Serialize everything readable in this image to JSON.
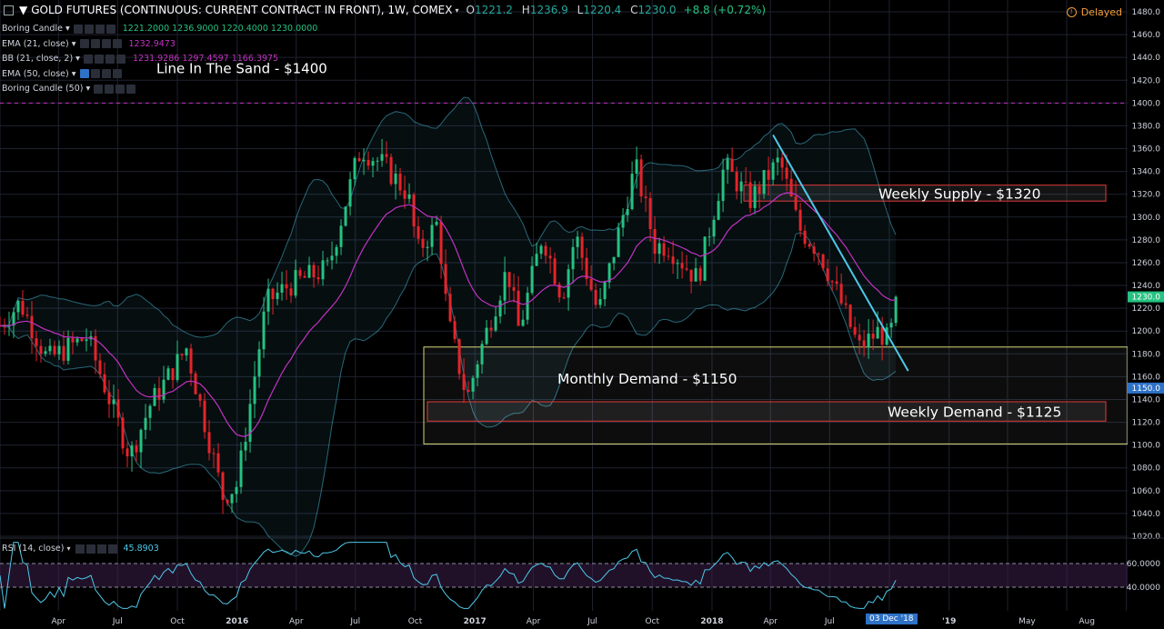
{
  "header": {
    "title": "GOLD FUTURES (CONTINUOUS: CURRENT CONTRACT IN FRONT), 1W, COMEX",
    "ohlc": {
      "o_label": "O",
      "o": "1221.2",
      "h_label": "H",
      "h": "1236.9",
      "l_label": "L",
      "l": "1220.4",
      "c_label": "C",
      "c": "1230.0"
    },
    "change": "+8.8 (+0.72%)",
    "delayed": "Delayed"
  },
  "indicators": [
    {
      "label": "Boring Candle",
      "values": [
        "1221.2000",
        "1236.9000",
        "1220.4000",
        "1230.0000"
      ],
      "color": "#26c281"
    },
    {
      "label": "EMA (21, close)",
      "values": [
        "1232.9473"
      ],
      "color": "#c232c2"
    },
    {
      "label": "BB (21, close, 2)",
      "values": [
        "1231.9286",
        "1297.4597",
        "1166.3975"
      ],
      "color": "#c232c2"
    },
    {
      "label": "EMA (50, close)",
      "values": [],
      "color": "#cfd3dc"
    },
    {
      "label": "Boring Candle (50)",
      "values": [],
      "color": "#cfd3dc"
    }
  ],
  "rsi": {
    "label": "RSI (14, close)",
    "value": "45.8903",
    "color": "#4ec8e8"
  },
  "date_tag": "03 Dec '18",
  "chart_data": {
    "type": "candlestick",
    "title": "GOLD FUTURES (CONTINUOUS: CURRENT CONTRACT IN FRONT), 1W, COMEX",
    "ylim": [
      1020,
      1480
    ],
    "y_ticks": [
      1020,
      1040,
      1060,
      1080,
      1100,
      1120,
      1140,
      1160,
      1180,
      1200,
      1220,
      1240,
      1260,
      1280,
      1300,
      1320,
      1340,
      1360,
      1380,
      1400,
      1420,
      1440,
      1460,
      1480
    ],
    "x_ticks": [
      "Apr",
      "Jul",
      "Oct",
      "2016",
      "Apr",
      "Jul",
      "Oct",
      "2017",
      "Apr",
      "Jul",
      "Oct",
      "2018",
      "Apr",
      "Jul",
      "Oct",
      "'19",
      "May",
      "Aug"
    ],
    "price_anchors": [
      [
        "2015-01-01",
        1205
      ],
      [
        "2015-02-01",
        1225
      ],
      [
        "2015-03-15",
        1175
      ],
      [
        "2015-05-15",
        1195
      ],
      [
        "2015-07-20",
        1090
      ],
      [
        "2015-08-20",
        1135
      ],
      [
        "2015-10-15",
        1185
      ],
      [
        "2015-12-10",
        1055
      ],
      [
        "2016-01-01",
        1065
      ],
      [
        "2016-02-15",
        1225
      ],
      [
        "2016-03-20",
        1240
      ],
      [
        "2016-05-20",
        1255
      ],
      [
        "2016-07-01",
        1345
      ],
      [
        "2016-07-10",
        1360
      ],
      [
        "2016-08-15",
        1345
      ],
      [
        "2016-09-20",
        1320
      ],
      [
        "2016-10-05",
        1270
      ],
      [
        "2016-11-05",
        1295
      ],
      [
        "2016-11-20",
        1210
      ],
      [
        "2016-12-20",
        1140
      ],
      [
        "2017-01-05",
        1175
      ],
      [
        "2017-02-20",
        1255
      ],
      [
        "2017-03-10",
        1200
      ],
      [
        "2017-04-15",
        1285
      ],
      [
        "2017-05-15",
        1230
      ],
      [
        "2017-06-05",
        1285
      ],
      [
        "2017-07-10",
        1215
      ],
      [
        "2017-09-05",
        1345
      ],
      [
        "2017-10-05",
        1275
      ],
      [
        "2017-10-25",
        1275
      ],
      [
        "2017-12-10",
        1245
      ],
      [
        "2018-01-20",
        1345
      ],
      [
        "2018-03-01",
        1315
      ],
      [
        "2018-04-15",
        1350
      ],
      [
        "2018-05-15",
        1290
      ],
      [
        "2018-06-15",
        1270
      ],
      [
        "2018-07-15",
        1230
      ],
      [
        "2018-08-15",
        1185
      ],
      [
        "2018-09-15",
        1200
      ],
      [
        "2018-10-01",
        1190
      ],
      [
        "2018-10-12",
        1230
      ]
    ],
    "last_price": 1230.0,
    "price_tag": "1230.0",
    "demand_tag": "1150.0",
    "levels": [
      {
        "label": "Line In The Sand - $1400",
        "price": 1400,
        "style": "dashed",
        "color": "#c232c2"
      },
      {
        "label": "Weekly Supply - $1320",
        "top": 1328,
        "bottom": 1314,
        "color": "#e03a3a"
      },
      {
        "label": "Monthly Demand - $1150",
        "top": 1186,
        "bottom": 1101,
        "color": "#d8d87a"
      },
      {
        "label": "Weekly Demand - $1125",
        "top": 1138,
        "bottom": 1121,
        "color": "#e03a3a"
      }
    ],
    "trendline": {
      "from": [
        "2018-04-05",
        1372
      ],
      "to": [
        "2018-10-30",
        1165
      ],
      "color": "#4ec8e8"
    },
    "rsi_levels": [
      60,
      40
    ],
    "rsi_ticks": [
      "60.0000",
      "40.0000"
    ],
    "rsi_last": 45.8903,
    "colors": {
      "up": "#26c281",
      "down": "#e5242b",
      "ema": "#c232c2",
      "bb": "#4ec8e8",
      "grid": "#1f2230",
      "axis_text": "#cfd3dc"
    }
  }
}
